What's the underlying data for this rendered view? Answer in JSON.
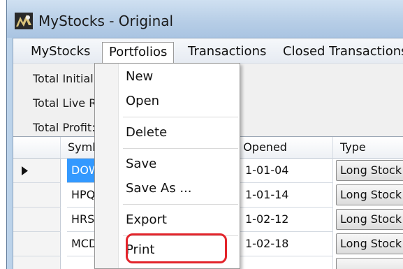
{
  "window": {
    "title": "MyStocks - Original",
    "icon": "app-icon"
  },
  "menubar": {
    "items": [
      {
        "label": "MyStocks"
      },
      {
        "label": "Portfolios",
        "open": true
      },
      {
        "label": "Transactions"
      },
      {
        "label": "Closed Transactions"
      }
    ]
  },
  "summary": {
    "total_initial": "Total Initial",
    "total_live": "Total Live Ri",
    "total_profit": "Total Profit:"
  },
  "portfolios_menu": {
    "items": [
      "New",
      "Open",
      "Delete",
      "Save",
      "Save As ...",
      "Export",
      "Print"
    ],
    "highlighted": "Print"
  },
  "grid": {
    "columns": [
      "Symbo",
      "te Opened",
      "Type"
    ],
    "rows": [
      {
        "symbol": "DOW",
        "opened": "1-01-04",
        "type": "Long Stock",
        "selected": true
      },
      {
        "symbol": "HPQ",
        "opened": "1-01-14",
        "type": "Long Stock"
      },
      {
        "symbol": "HRS",
        "opened": "1-02-12",
        "type": "Long Stock"
      },
      {
        "symbol": "MCD",
        "opened": "1-02-18",
        "type": "Long Stock"
      }
    ]
  },
  "colors": {
    "selection": "#3399ff",
    "highlight_circle": "#e3242b",
    "titlebar": "#b6cde6"
  }
}
